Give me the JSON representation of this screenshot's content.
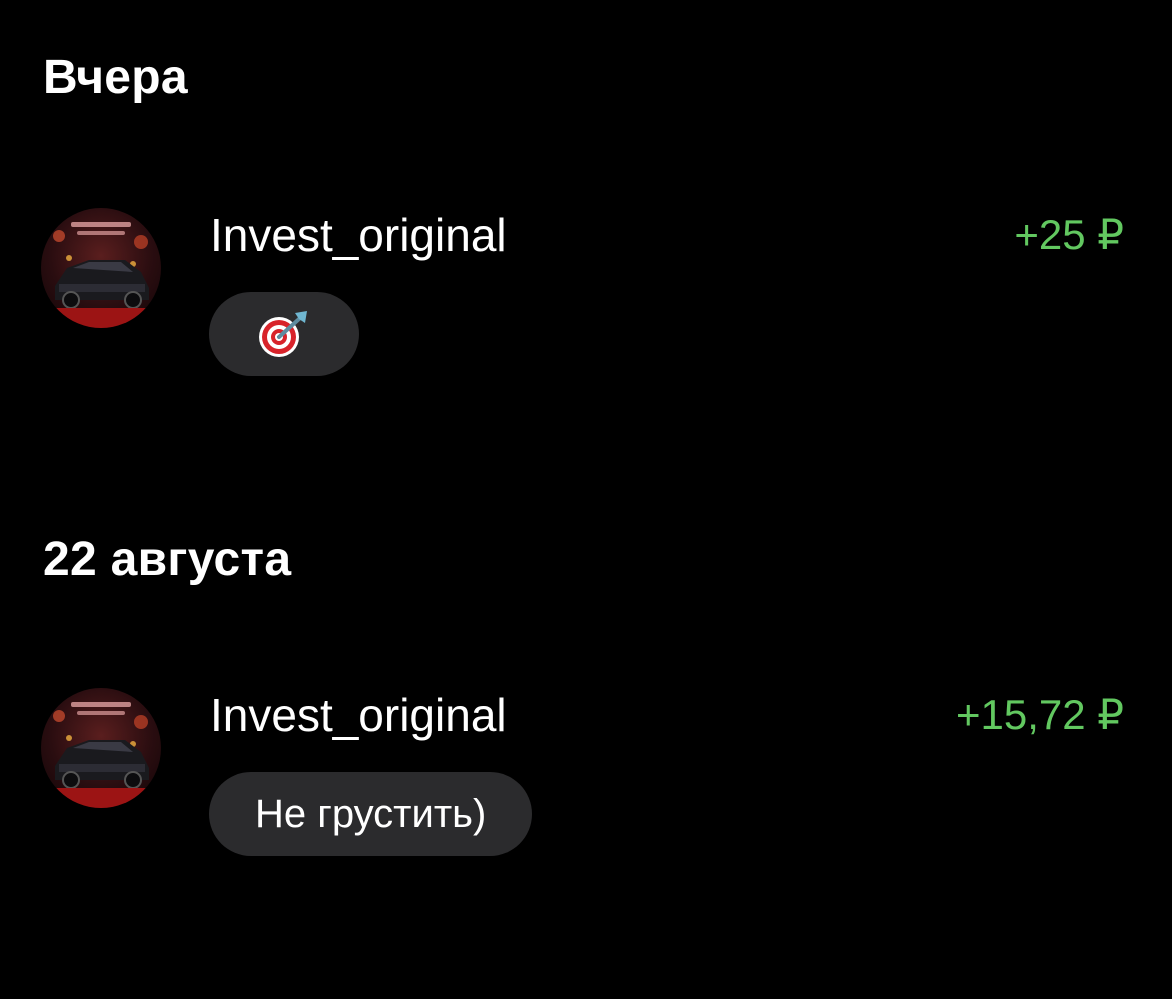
{
  "sections": [
    {
      "header": "Вчера",
      "transaction": {
        "sender": "Invest_original",
        "amount": "+25 ₽",
        "message_icon": "direct-hit-dart-icon"
      }
    },
    {
      "header": "22 августа",
      "transaction": {
        "sender": "Invest_original",
        "amount": "+15,72 ₽",
        "message": "Не грустить)"
      }
    }
  ],
  "colors": {
    "background": "#000000",
    "income_amount": "#62c860",
    "bubble": "#2b2b2d",
    "text": "#ffffff"
  }
}
